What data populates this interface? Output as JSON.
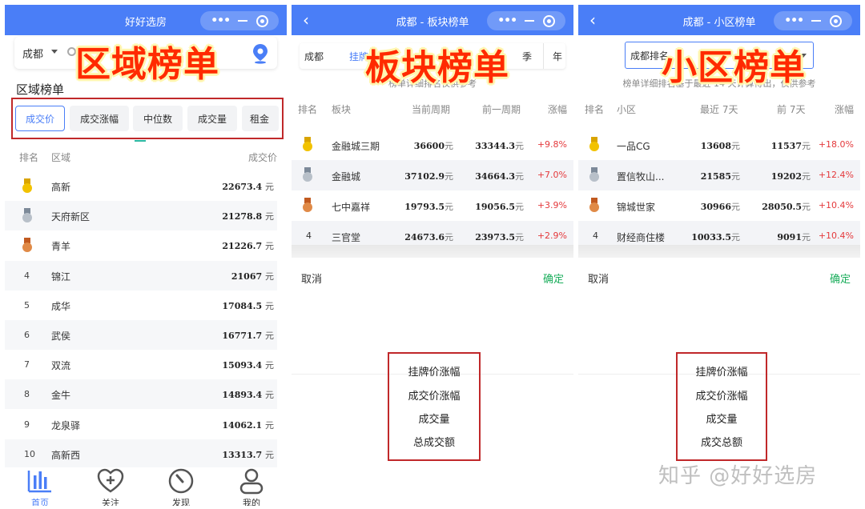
{
  "panel1": {
    "window_title": "好好选房",
    "overlay_title": "区域榜单",
    "city": "成都",
    "section_title": "区域榜单",
    "tabs": [
      "成交价",
      "成交涨幅",
      "中位数",
      "成交量",
      "租金"
    ],
    "active_tab": 0,
    "headers": {
      "rank": "排名",
      "area": "区域",
      "price": "成交价"
    },
    "unit": "元",
    "rows": [
      {
        "rank": "1",
        "name": "高新",
        "price": "22673.4"
      },
      {
        "rank": "2",
        "name": "天府新区",
        "price": "21278.8"
      },
      {
        "rank": "3",
        "name": "青羊",
        "price": "21226.7"
      },
      {
        "rank": "4",
        "name": "锦江",
        "price": "21067"
      },
      {
        "rank": "5",
        "name": "成华",
        "price": "17084.5"
      },
      {
        "rank": "6",
        "name": "武侯",
        "price": "16771.7"
      },
      {
        "rank": "7",
        "name": "双流",
        "price": "15093.4"
      },
      {
        "rank": "8",
        "name": "金牛",
        "price": "14893.4"
      },
      {
        "rank": "9",
        "name": "龙泉驿",
        "price": "14062.1"
      },
      {
        "rank": "10",
        "name": "高新西",
        "price": "13313.7"
      }
    ],
    "nav": [
      {
        "label": "首页",
        "icon": "bar-chart-icon"
      },
      {
        "label": "关注",
        "icon": "heart-plus-icon"
      },
      {
        "label": "发现",
        "icon": "compass-icon"
      },
      {
        "label": "我的",
        "icon": "user-icon"
      }
    ]
  },
  "panel2": {
    "window_title": "成都 - 板块榜单",
    "overlay_title": "板块榜单",
    "filter": {
      "city": "成都",
      "metric": "挂牌",
      "season": "季",
      "year": "年"
    },
    "note": "榜单详细排名仅供参考",
    "headers": {
      "rank": "排名",
      "name": "板块",
      "current": "当前周期",
      "previous": "前一周期",
      "change": "涨幅"
    },
    "unit": "元",
    "rows": [
      {
        "rank": "1",
        "name": "金融城三期",
        "current": "36600",
        "previous": "33344.3",
        "change": "+9.8%"
      },
      {
        "rank": "2",
        "name": "金融城",
        "current": "37102.9",
        "previous": "34664.3",
        "change": "+7.0%"
      },
      {
        "rank": "3",
        "name": "七中嘉祥",
        "current": "19793.5",
        "previous": "19056.5",
        "change": "+3.9%"
      },
      {
        "rank": "4",
        "name": "三官堂",
        "current": "24673.6",
        "previous": "23973.5",
        "change": "+2.9%"
      }
    ],
    "cancel": "取消",
    "confirm": "确定",
    "options": [
      "挂牌价涨幅",
      "成交价涨幅",
      "成交量",
      "总成交额"
    ]
  },
  "panel3": {
    "window_title": "成都 - 小区榜单",
    "overlay_title": "小区榜单",
    "filter": {
      "select": "成都排名"
    },
    "note": "榜单详细排名基于最近 14 天计算得出，仅供参考",
    "headers": {
      "rank": "排名",
      "name": "小区",
      "recent": "最近 7天",
      "prev": "前 7天",
      "change": "涨幅"
    },
    "unit": "元",
    "rows": [
      {
        "rank": "1",
        "name": "一品CG",
        "recent": "13608",
        "prev": "11537",
        "change": "+18.0%"
      },
      {
        "rank": "2",
        "name": "置信牧山...",
        "recent": "21585",
        "prev": "19202",
        "change": "+12.4%"
      },
      {
        "rank": "3",
        "name": "锦城世家",
        "recent": "30966",
        "prev": "28050.5",
        "change": "+10.4%"
      },
      {
        "rank": "4",
        "name": "财经商住楼",
        "recent": "10033.5",
        "prev": "9091",
        "change": "+10.4%"
      }
    ],
    "cancel": "取消",
    "confirm": "确定",
    "options": [
      "挂牌价涨幅",
      "成交价涨幅",
      "成交量",
      "成交总额"
    ]
  },
  "watermark": "知乎 @好好选房",
  "colors": {
    "brand": "#4a7ef7",
    "highlight": "#c0282a",
    "overlay": "#ff2a00",
    "up": "#e4393c",
    "confirm": "#1aad5b"
  }
}
